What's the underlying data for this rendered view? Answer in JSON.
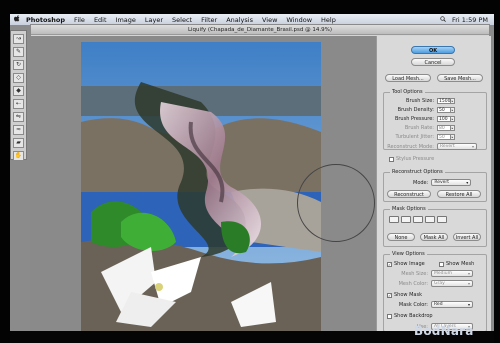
{
  "menubar": {
    "apple": "",
    "app_name": "Photoshop",
    "items": [
      "File",
      "Edit",
      "Image",
      "Layer",
      "Select",
      "Filter",
      "Analysis",
      "View",
      "Window",
      "Help"
    ],
    "clock": "Fri 1:59 PM"
  },
  "dialog": {
    "title": "Liquify (Chapada_de_Diamante_Brasil.psd @ 14.9%)"
  },
  "panel": {
    "ok": "OK",
    "cancel": "Cancel",
    "load_mesh": "Load Mesh...",
    "save_mesh": "Save Mesh...",
    "tool_options": {
      "title": "Tool Options",
      "brush_size_label": "Brush Size:",
      "brush_size": "1500",
      "brush_density_label": "Brush Density:",
      "brush_density": "50",
      "brush_pressure_label": "Brush Pressure:",
      "brush_pressure": "100",
      "brush_rate_label": "Brush Rate:",
      "brush_rate": "80",
      "turbulent_jitter_label": "Turbulent Jitter:",
      "turbulent_jitter": "50",
      "reconstruct_mode_label": "Reconstruct Mode:",
      "reconstruct_mode": "Revert",
      "stylus_pressure_label": "Stylus Pressure"
    },
    "reconstruct_options": {
      "title": "Reconstruct Options",
      "mode_label": "Mode:",
      "mode": "Revert",
      "reconstruct": "Reconstruct",
      "restore_all": "Restore All"
    },
    "mask_options": {
      "title": "Mask Options",
      "none": "None",
      "mask_all": "Mask All",
      "invert_all": "Invert All"
    },
    "view_options": {
      "title": "View Options",
      "show_image": "Show Image",
      "show_mesh": "Show Mesh",
      "mesh_size_label": "Mesh Size:",
      "mesh_size": "Medium",
      "mesh_color_label": "Mesh Color:",
      "mesh_color": "Gray",
      "show_mask": "Show Mask",
      "mask_color_label": "Mask Color:",
      "mask_color": "Red",
      "show_backdrop": "Show Backdrop",
      "use_label": "Use:",
      "use": "All Layers"
    }
  },
  "watermark": "BodNara"
}
